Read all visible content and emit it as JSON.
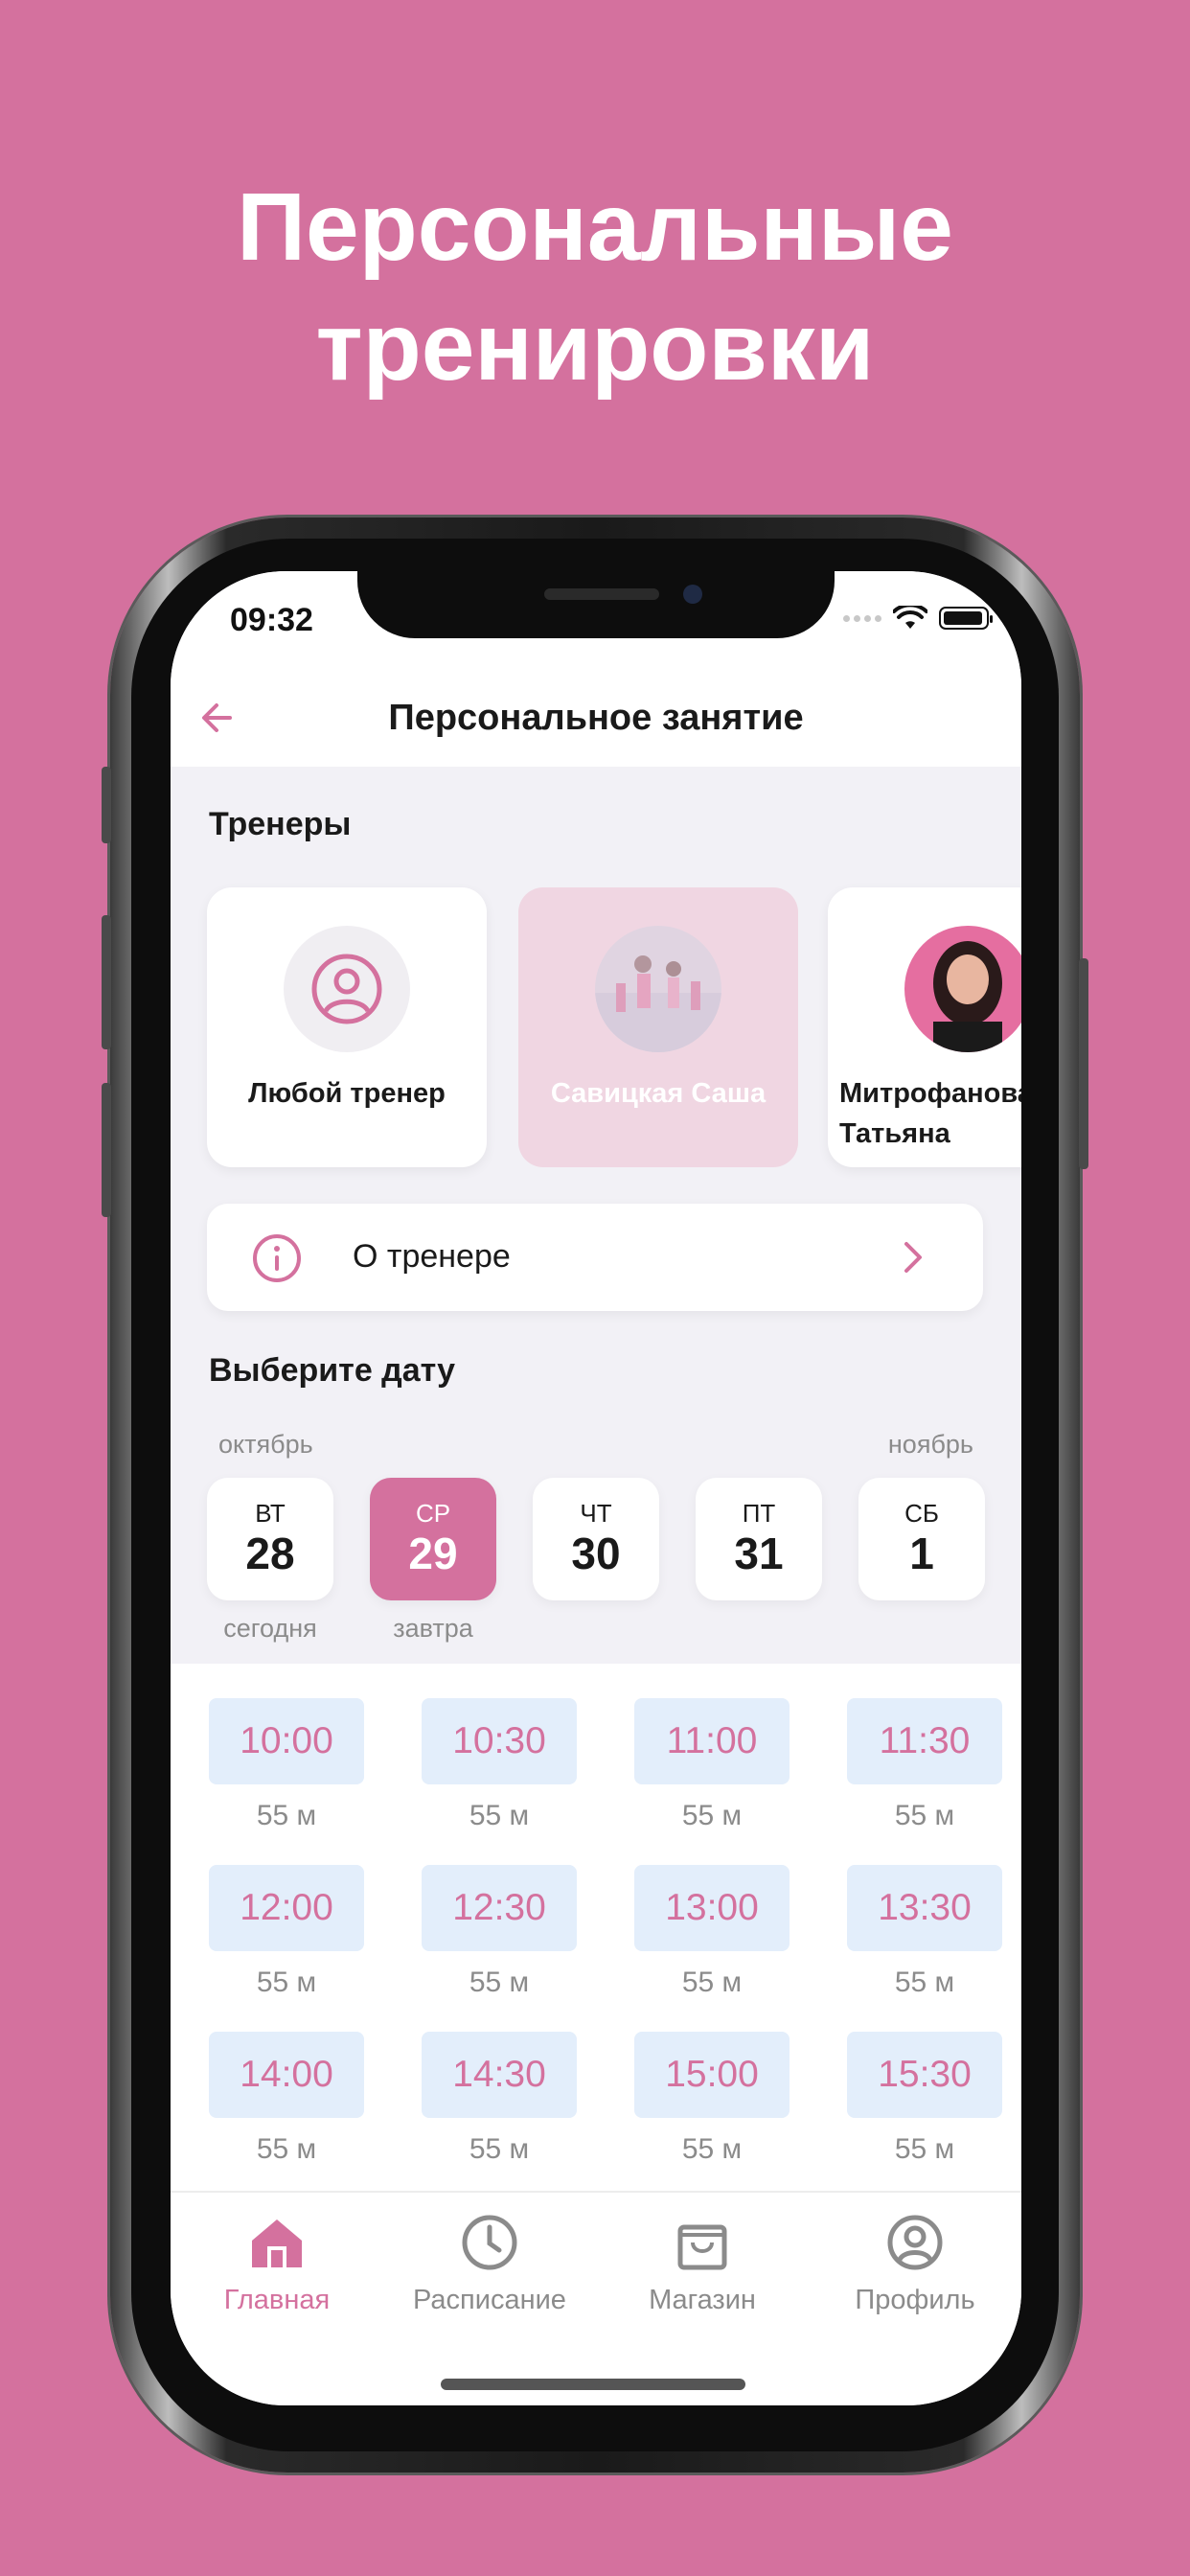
{
  "headline": {
    "line1": "Персональные",
    "line2": "тренировки"
  },
  "status_bar": {
    "time": "09:32"
  },
  "nav": {
    "title": "Персональное занятие",
    "back_icon": "arrow-left-icon"
  },
  "trainers": {
    "title": "Тренеры",
    "items": [
      {
        "name": "Любой тренер",
        "icon": "user-circle-icon",
        "selected": false
      },
      {
        "name": "Савицкая Саша",
        "icon": "photo",
        "selected": true
      },
      {
        "name": "Митрофанова Татьяна",
        "icon": "photo",
        "selected": false
      }
    ]
  },
  "about": {
    "label": "О тренере",
    "icon": "info-icon",
    "chevron": "chevron-right-icon"
  },
  "date_picker": {
    "title": "Выберите дату",
    "month_left": "октябрь",
    "month_right": "ноябрь",
    "days": [
      {
        "dow": "ВТ",
        "num": "28",
        "sub": "сегодня",
        "active": false
      },
      {
        "dow": "СР",
        "num": "29",
        "sub": "завтра",
        "active": true
      },
      {
        "dow": "ЧТ",
        "num": "30",
        "sub": "",
        "active": false
      },
      {
        "dow": "ПТ",
        "num": "31",
        "sub": "",
        "active": false
      },
      {
        "dow": "СБ",
        "num": "1",
        "sub": "",
        "active": false
      }
    ]
  },
  "slots": [
    {
      "time": "10:00",
      "duration": "55 м"
    },
    {
      "time": "10:30",
      "duration": "55 м"
    },
    {
      "time": "11:00",
      "duration": "55 м"
    },
    {
      "time": "11:30",
      "duration": "55 м"
    },
    {
      "time": "12:00",
      "duration": "55 м"
    },
    {
      "time": "12:30",
      "duration": "55 м"
    },
    {
      "time": "13:00",
      "duration": "55 м"
    },
    {
      "time": "13:30",
      "duration": "55 м"
    },
    {
      "time": "14:00",
      "duration": "55 м"
    },
    {
      "time": "14:30",
      "duration": "55 м"
    },
    {
      "time": "15:00",
      "duration": "55 м"
    },
    {
      "time": "15:30",
      "duration": "55 м"
    }
  ],
  "tabs": [
    {
      "label": "Главная",
      "icon": "home-icon",
      "active": true
    },
    {
      "label": "Расписание",
      "icon": "clock-icon",
      "active": false
    },
    {
      "label": "Магазин",
      "icon": "shopping-bag-icon",
      "active": false
    },
    {
      "label": "Профиль",
      "icon": "profile-icon",
      "active": false
    }
  ],
  "colors": {
    "accent": "#D4719E",
    "slot_bg": "#E3EEFB",
    "background": "#F2F1F6"
  }
}
